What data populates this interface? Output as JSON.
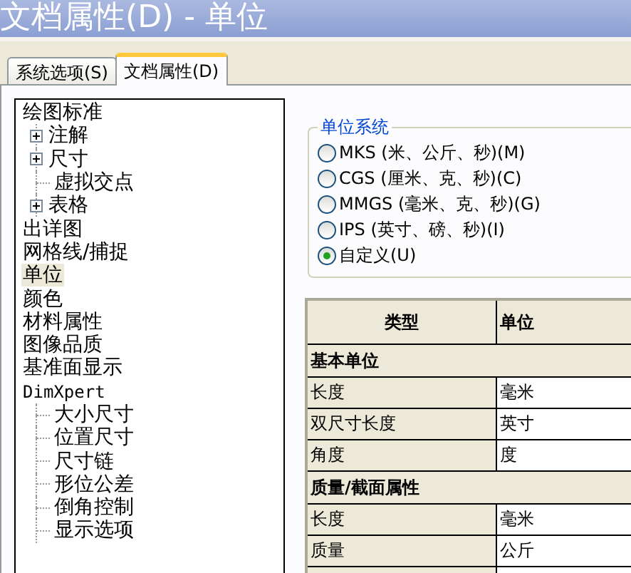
{
  "window": {
    "title": "文档属性(D) - 单位"
  },
  "tabs": [
    {
      "label": "系统选项(S)",
      "selected": false
    },
    {
      "label": "文档属性(D)",
      "selected": true
    }
  ],
  "tree": [
    {
      "label": "绘图标准",
      "selected": false,
      "children": [
        {
          "label": "注解",
          "selected": false,
          "expandable": true
        },
        {
          "label": "尺寸",
          "selected": false,
          "expandable": true
        },
        {
          "label": "虚拟交点",
          "selected": false,
          "expandable": false
        },
        {
          "label": "表格",
          "selected": false,
          "expandable": true
        }
      ]
    },
    {
      "label": "出详图",
      "selected": false
    },
    {
      "label": "网格线/捕捉",
      "selected": false
    },
    {
      "label": "单位",
      "selected": true
    },
    {
      "label": "颜色",
      "selected": false
    },
    {
      "label": "材料属性",
      "selected": false
    },
    {
      "label": "图像品质",
      "selected": false
    },
    {
      "label": "基准面显示",
      "selected": false
    },
    {
      "label": "DimXpert",
      "selected": false,
      "kind": "latin",
      "children": [
        {
          "label": "大小尺寸",
          "selected": false,
          "expandable": false
        },
        {
          "label": "位置尺寸",
          "selected": false,
          "expandable": false
        },
        {
          "label": "尺寸链",
          "selected": false,
          "expandable": false
        },
        {
          "label": "形位公差",
          "selected": false,
          "expandable": false
        },
        {
          "label": "倒角控制",
          "selected": false,
          "expandable": false
        },
        {
          "label": "显示选项",
          "selected": false,
          "expandable": false
        }
      ]
    }
  ],
  "unit_system": {
    "title": "单位系统",
    "options": [
      {
        "label": "MKS (米、公斤、秒)(M)",
        "selected": false
      },
      {
        "label": "CGS (厘米、克、秒)(C)",
        "selected": false
      },
      {
        "label": "MMGS (毫米、克、秒)(G)",
        "selected": false
      },
      {
        "label": "IPS (英寸、磅、秒)(I)",
        "selected": false
      },
      {
        "label": "自定义(U)",
        "selected": true
      }
    ]
  },
  "table": {
    "columns": [
      "类型",
      "单位"
    ],
    "rows": [
      {
        "kind": "section",
        "label": "基本单位"
      },
      {
        "kind": "row",
        "label": "长度",
        "value": "毫米"
      },
      {
        "kind": "row",
        "label": "双尺寸长度",
        "value": "英寸"
      },
      {
        "kind": "row",
        "label": "角度",
        "value": "度"
      },
      {
        "kind": "section",
        "label": "质量/截面属性"
      },
      {
        "kind": "row",
        "label": "长度",
        "value": "毫米"
      },
      {
        "kind": "row",
        "label": "质量",
        "value": "公斤"
      }
    ]
  }
}
